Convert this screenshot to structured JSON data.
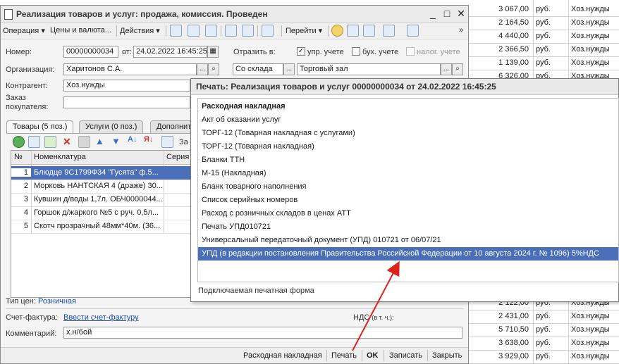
{
  "background_sheet": {
    "rows": [
      {
        "amount": "3 067,00",
        "currency": "руб.",
        "category": "Хоз.нужды"
      },
      {
        "amount": "2 164,50",
        "currency": "руб.",
        "category": "Хоз.нужды"
      },
      {
        "amount": "4 440,00",
        "currency": "руб.",
        "category": "Хоз.нужды"
      },
      {
        "amount": "2 366,50",
        "currency": "руб.",
        "category": "Хоз.нужды"
      },
      {
        "amount": "1 139,00",
        "currency": "руб.",
        "category": "Хоз.нужды"
      },
      {
        "amount": "6 326,00",
        "currency": "руб.",
        "category": "Хоз.нужды"
      }
    ],
    "rows_bottom": [
      {
        "amount": "2 122,00",
        "currency": "руб.",
        "category": "Хоз.нужды"
      },
      {
        "amount": "2 431,00",
        "currency": "руб.",
        "category": "Хоз.нужды"
      },
      {
        "amount": "5 710,50",
        "currency": "руб.",
        "category": "Хоз.нужды"
      },
      {
        "amount": "3 638,00",
        "currency": "руб.",
        "category": "Хоз.нужды"
      },
      {
        "amount": "3 929,00",
        "currency": "руб.",
        "category": "Хоз.нужды"
      }
    ]
  },
  "window": {
    "title": "Реализация товаров и услуг: продажа, комиссия. Проведен",
    "toolbar": {
      "operation": "Операция",
      "prices": "Цены и валюта...",
      "actions": "Действия",
      "goto": "Перейти"
    },
    "form": {
      "number_label": "Номер:",
      "number_value": "00000000034",
      "from_label": "от:",
      "date_value": "24.02.2022 16:45:25",
      "reflect_label": "Отразить в:",
      "mgmt_label": "упр. учете",
      "acc_label": "бух. учете",
      "tax_label": "налог. учете",
      "org_label": "Организация:",
      "org_value": "Харитонов С.А.",
      "warehouse_mode": "Со склада",
      "warehouse_value": "Торговый зал",
      "counterparty_label": "Контрагент:",
      "counterparty_value": "Хоз.нужды",
      "order_label_1": "Заказ",
      "order_label_2": "покупателя:"
    },
    "tabs": [
      "Товары (5 поз.)",
      "Услуги (0 поз.)",
      "Дополнит"
    ],
    "grid": {
      "toolbar_tail": "За",
      "col_num": "№",
      "col_name": "Номенклатура",
      "col_series": "Серия",
      "rows": [
        {
          "n": "1",
          "name": "Блюдце 9С1799Ф34 \"Гусята\" ф.5..."
        },
        {
          "n": "2",
          "name": "Морковь НАНТСКАЯ 4 (драже) 30..."
        },
        {
          "n": "3",
          "name": "Кувшин д/воды 1,7л. ОБЧ0000044..."
        },
        {
          "n": "4",
          "name": "Горшок д/жаркого №5 с руч. 0,5л..."
        },
        {
          "n": "5",
          "name": "Скотч прозрачный 48мм*40м. (36..."
        }
      ]
    },
    "price_type_label": "Тип цен:",
    "price_type_value": "Розничная",
    "invoice_label": "Счет-фактура:",
    "invoice_link": "Ввести счет-фактуру",
    "vat_label": "НДС",
    "vat_suffix": "(в т. ч.):",
    "comment_label": "Комментарий:",
    "comment_value": "х.н/бой",
    "bottom": {
      "waybill": "Расходная накладная",
      "print": "Печать",
      "ok": "OK",
      "save": "Записать",
      "close": "Закрыть"
    }
  },
  "print_popup": {
    "title": "Печать: Реализация товаров и услуг 00000000034 от 24.02.2022 16:45:25",
    "items": [
      {
        "label": "Расходная накладная",
        "bold": true
      },
      {
        "label": "Акт об оказании услуг"
      },
      {
        "label": "ТОРГ-12 (Товарная накладная с услугами)"
      },
      {
        "label": "ТОРГ-12 (Товарная накладная)"
      },
      {
        "label": "Бланки ТТН"
      },
      {
        "label": "М-15 (Накладная)"
      },
      {
        "label": "Бланк товарного наполнения"
      },
      {
        "label": "Список серийных номеров"
      },
      {
        "label": "Расход с розничных складов в ценах АТТ"
      },
      {
        "label": "Печать УПД010721"
      },
      {
        "label": "Универсальный передаточный документ (УПД) 010721 от 06/07/21"
      },
      {
        "label": "УПД (в редакции постановления Правительства Российской Федерации от 10 августа 2024 г. № 1096) 5%НДС",
        "selected": true
      }
    ],
    "footer": "Подключаемая печатная форма"
  },
  "colors": {
    "selection": "#4a6fb8",
    "arrow": "#e0201b",
    "link": "#1f4fa8"
  }
}
